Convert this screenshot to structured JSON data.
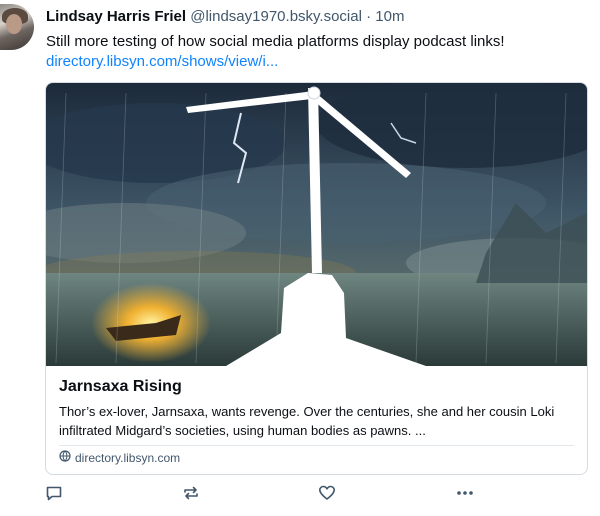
{
  "post": {
    "author_name": "Lindsay Harris Friel",
    "handle": "@lindsay1970.bsky.social",
    "separator": "·",
    "time": "10m",
    "text": "Still more testing of how social media platforms display podcast links!",
    "link_text": "directory.libsyn.com/shows/view/i..."
  },
  "embed": {
    "title": "Jarnsaxa Rising",
    "description": "Thor’s ex-lover, Jarnsaxa, wants revenge. Over the centuries, she and her cousin Loki infiltrated Midgard’s societies, using human bodies as pawns. ...",
    "domain": "directory.libsyn.com"
  },
  "actions": [
    {
      "name": "reply",
      "icon": "comment-icon"
    },
    {
      "name": "repost",
      "icon": "repost-icon"
    },
    {
      "name": "like",
      "icon": "heart-icon"
    },
    {
      "name": "more",
      "icon": "more-icon"
    }
  ],
  "colors": {
    "link": "#1083fe",
    "muted": "#42576c",
    "border": "#d4dbe2"
  }
}
